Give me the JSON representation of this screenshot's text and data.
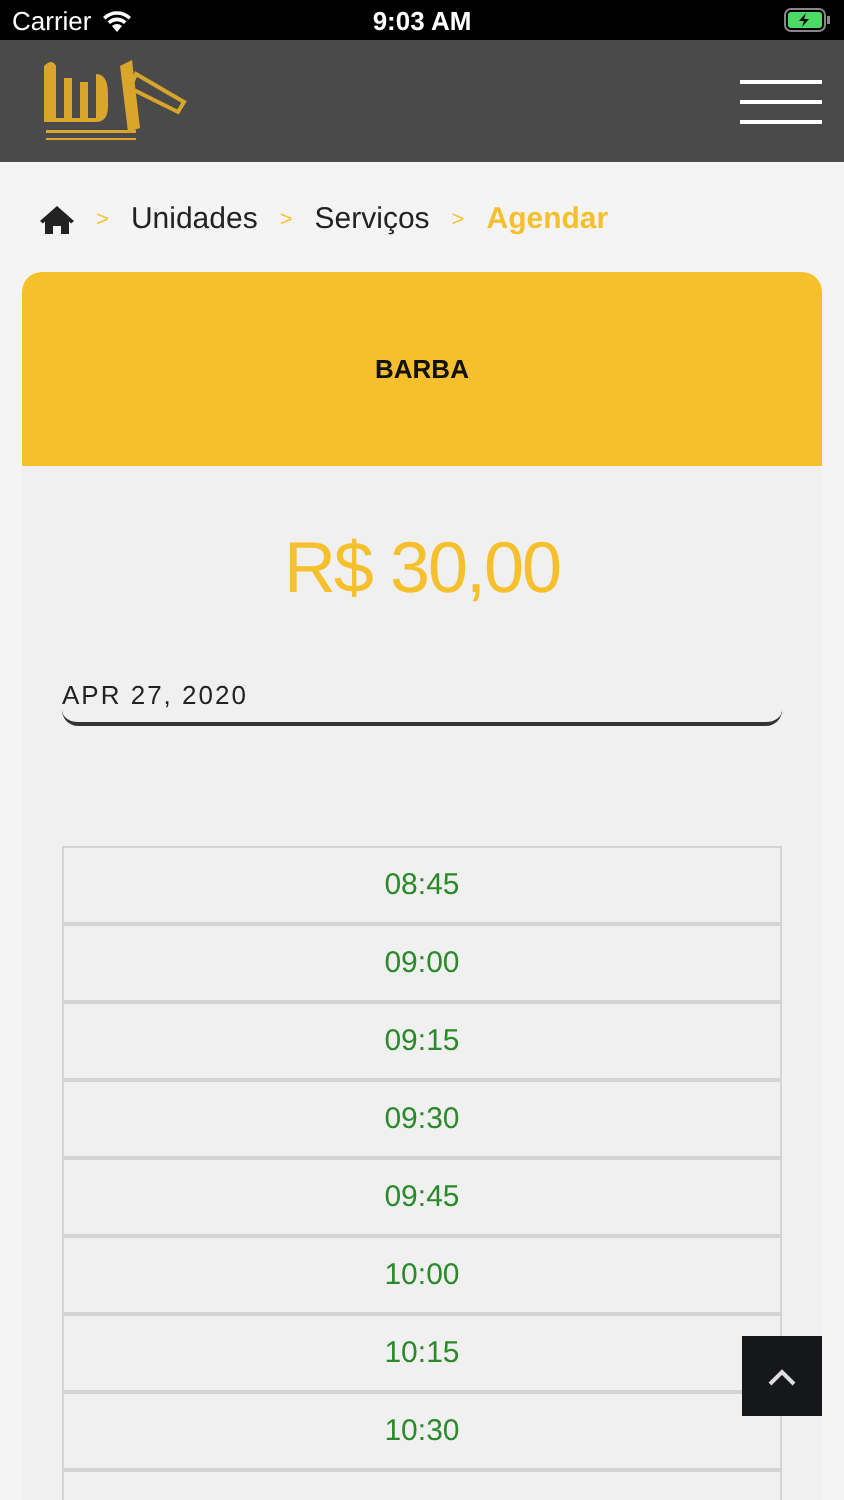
{
  "status_bar": {
    "carrier": "Carrier",
    "time": "9:03 AM"
  },
  "breadcrumb": [
    {
      "label": "Unidades",
      "selected": false
    },
    {
      "label": "Serviços",
      "selected": false
    },
    {
      "label": "Agendar",
      "selected": true
    }
  ],
  "breadcrumb_separator": ">",
  "service": {
    "title": "BARBA",
    "price": "R$ 30,00"
  },
  "date_field": {
    "value": "APR 27, 2020"
  },
  "time_slots": [
    "08:45",
    "09:00",
    "09:15",
    "09:30",
    "09:45",
    "10:00",
    "10:15",
    "10:30"
  ]
}
